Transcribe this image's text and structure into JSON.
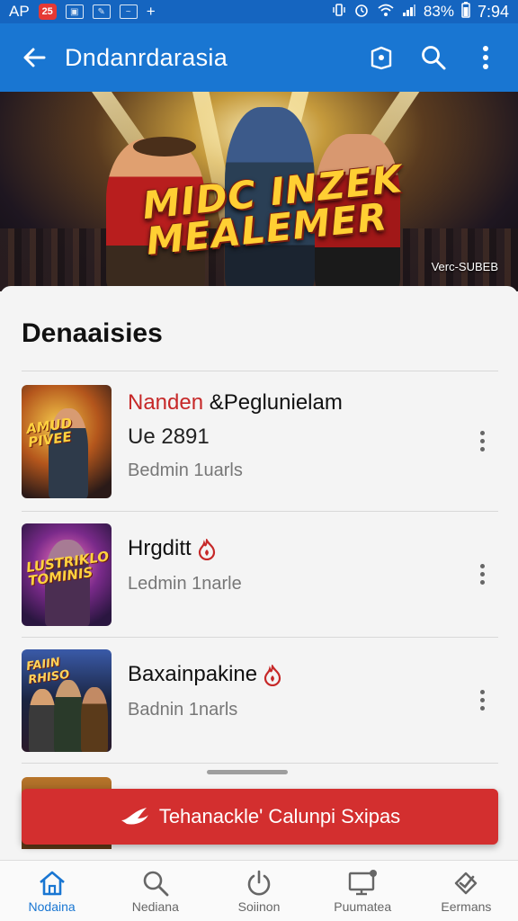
{
  "status_bar": {
    "left_text": "AP",
    "notif_badge": "25",
    "plus": "+",
    "battery": "83%",
    "time": "7:94"
  },
  "app_bar": {
    "title": "Dndanrdarasia",
    "icons": [
      "back-arrow-icon",
      "settings-shield-icon",
      "search-icon",
      "more-vert-icon"
    ]
  },
  "hero": {
    "title_line1": "MIDC INZEK",
    "title_line2": "MEALEMER",
    "caption": "Verc-SUBEB",
    "colors": {
      "glow": "#f6e7b0",
      "title": "#ffcf33"
    }
  },
  "section": {
    "title": "Denaaisies",
    "items": [
      {
        "title_highlight": "Nanden",
        "title_rest": " &Peglunielam",
        "subtitle": "Ue 2891",
        "meta": "Bedmin 1uarls",
        "thumb_text": "AMUD PIVEE",
        "has_badge": false
      },
      {
        "title_highlight": "",
        "title_rest": "Hrgditt",
        "subtitle": "",
        "meta": "Ledmin 1narle",
        "thumb_text": "LUSTRIKLO TOMINIS",
        "has_badge": true
      },
      {
        "title_highlight": "",
        "title_rest": "Baxainpakine",
        "subtitle": "",
        "meta": "Badnin 1narls",
        "thumb_text": "FAIIN RHISO",
        "has_badge": true
      }
    ]
  },
  "cta": {
    "label": "Tehanackle' Calunpi Sxipas",
    "color": "#d32f2f"
  },
  "bottom_nav": {
    "items": [
      {
        "label": "Nodaina",
        "icon": "home-icon",
        "active": true
      },
      {
        "label": "Nediana",
        "icon": "search-icon",
        "active": false
      },
      {
        "label": "Soiinon",
        "icon": "power-icon",
        "active": false
      },
      {
        "label": "Puumatea",
        "icon": "monitor-icon",
        "active": false
      },
      {
        "label": "Eermans",
        "icon": "checkbox-icon",
        "active": false
      }
    ],
    "active_color": "#1976d2"
  }
}
